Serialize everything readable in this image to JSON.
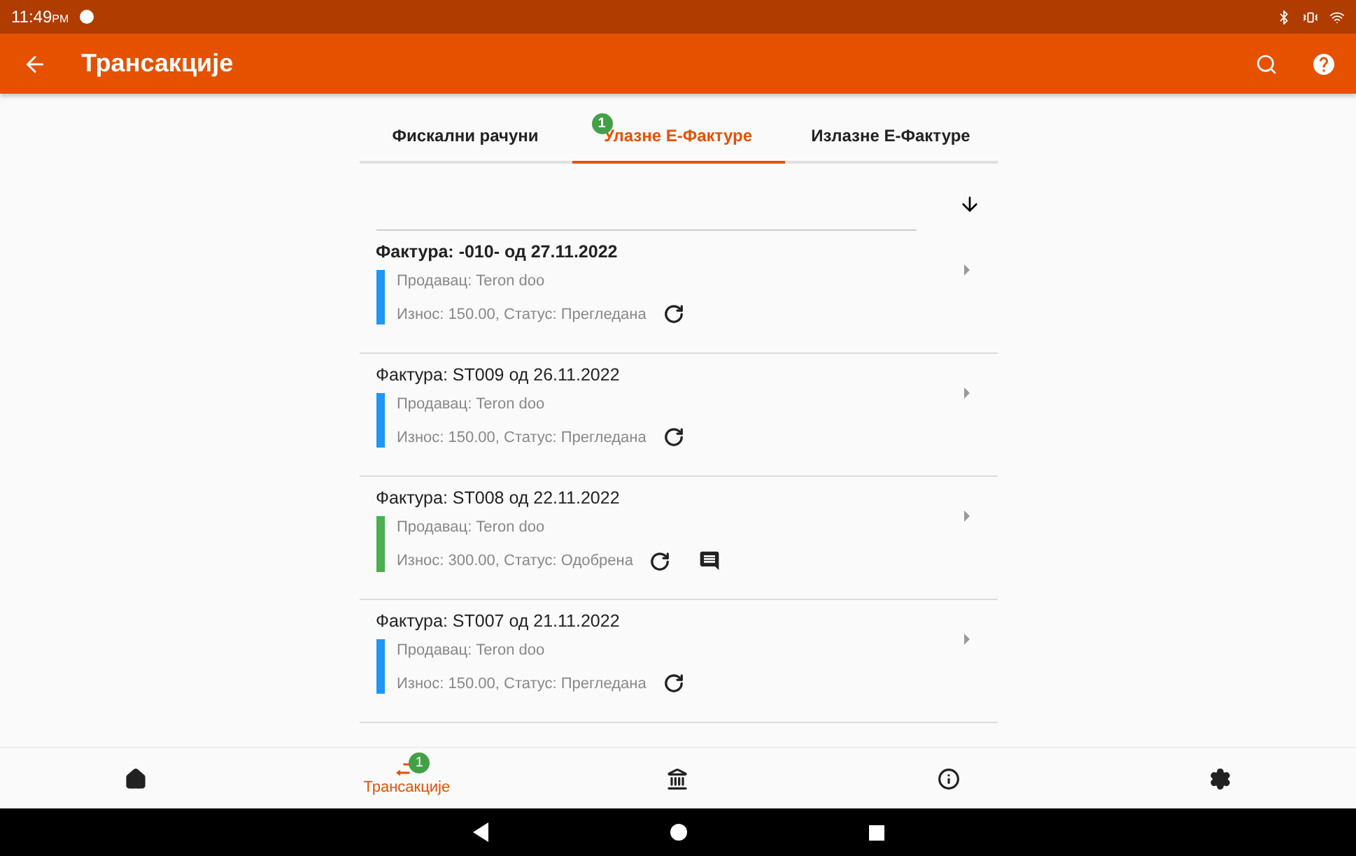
{
  "status_bar": {
    "time": "11:49",
    "ampm": "PM"
  },
  "app_bar": {
    "title": "Трансакције"
  },
  "tabs": [
    {
      "label": "Фискални рачуни",
      "selected": false
    },
    {
      "label": "Улазне Е-Фактуре",
      "selected": true,
      "badge": "1"
    },
    {
      "label": "Излазне Е-Фактуре",
      "selected": false
    }
  ],
  "invoices": [
    {
      "title": "Фактура: -010- од 27.11.2022",
      "unread": true,
      "seller": "Продавац: Teron doo",
      "details": "Износ: 150.00, Статус: Прегледана",
      "color": "#2196f3",
      "comment": false
    },
    {
      "title": "Фактура: ST009 од 26.11.2022",
      "unread": false,
      "seller": "Продавац: Teron doo",
      "details": "Износ: 150.00, Статус: Прегледана",
      "color": "#2196f3",
      "comment": false
    },
    {
      "title": "Фактура: ST008 од 22.11.2022",
      "unread": false,
      "seller": "Продавац: Teron doo",
      "details": "Износ: 300.00, Статус: Одобрена",
      "color": "#4caf50",
      "comment": true
    },
    {
      "title": "Фактура: ST007 од 21.11.2022",
      "unread": false,
      "seller": "Продавац: Teron doo",
      "details": "Износ: 150.00, Статус: Прегледана",
      "color": "#2196f3",
      "comment": false
    }
  ],
  "bottom_nav": [
    {
      "kind": "home",
      "selected": false
    },
    {
      "kind": "transactions",
      "selected": true,
      "label": "Трансакције",
      "badge": "1"
    },
    {
      "kind": "bank",
      "selected": false
    },
    {
      "kind": "info",
      "selected": false
    },
    {
      "kind": "settings",
      "selected": false
    }
  ]
}
